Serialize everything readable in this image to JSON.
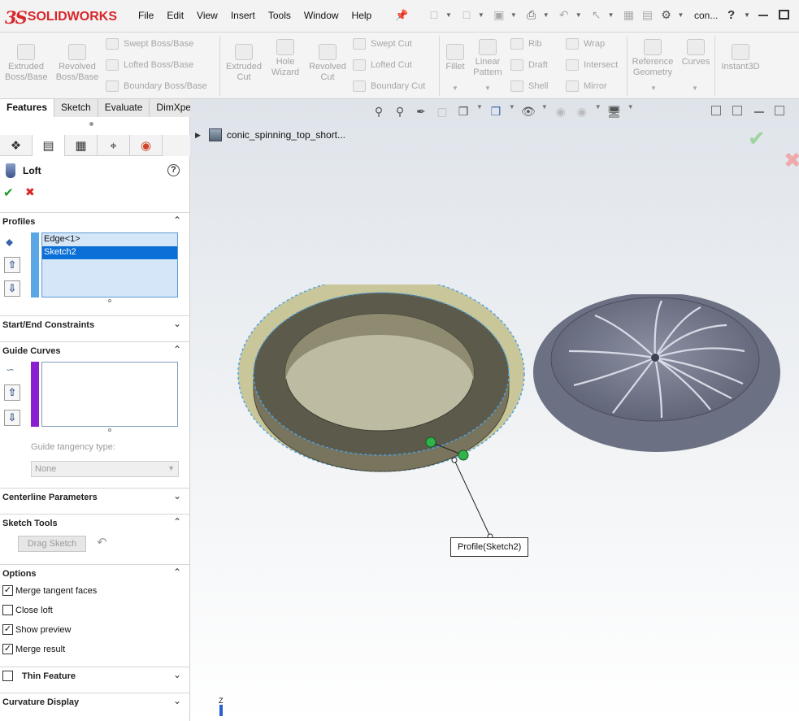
{
  "app": {
    "brand_ds": "3S",
    "brand_name": "SOLIDWORKS",
    "menus": [
      "File",
      "Edit",
      "View",
      "Insert",
      "Tools",
      "Window",
      "Help"
    ],
    "doc_name_short": "con...",
    "help_label": "?"
  },
  "icons": {
    "pin": "pin-icon",
    "new": "new-document-icon",
    "open": "open-icon",
    "save": "save-icon",
    "print": "print-icon",
    "undo": "undo-icon",
    "select": "select-icon",
    "rebuild": "rebuild-icon",
    "file_properties": "file-properties-icon",
    "options": "gear-icon"
  },
  "commands": {
    "extruded_boss": "Extruded\nBoss/Base",
    "revolved_boss": "Revolved\nBoss/Base",
    "swept_boss": "Swept Boss/Base",
    "lofted_boss": "Lofted Boss/Base",
    "boundary_boss": "Boundary Boss/Base",
    "extruded_cut": "Extruded\nCut",
    "hole_wizard": "Hole\nWizard",
    "revolved_cut": "Revolved\nCut",
    "swept_cut": "Swept Cut",
    "lofted_cut": "Lofted Cut",
    "boundary_cut": "Boundary Cut",
    "fillet": "Fillet",
    "linear_pattern": "Linear\nPattern",
    "rib": "Rib",
    "draft": "Draft",
    "shell": "Shell",
    "wrap": "Wrap",
    "intersect": "Intersect",
    "mirror": "Mirror",
    "reference_geometry": "Reference\nGeometry",
    "curves": "Curves",
    "instant3d": "Instant3D"
  },
  "tabs": [
    "Features",
    "Sketch",
    "Evaluate",
    "DimXpert"
  ],
  "property_manager": {
    "title": "Loft",
    "help": "?",
    "profiles_title": "Profiles",
    "profiles": [
      "Edge<1>",
      "Sketch2"
    ],
    "start_end_title": "Start/End Constraints",
    "guide_curves_title": "Guide Curves",
    "guide_tangency_label": "Guide tangency type:",
    "guide_tangency_value": "None",
    "centerline_title": "Centerline Parameters",
    "sketch_tools_title": "Sketch Tools",
    "drag_sketch_label": "Drag Sketch",
    "options_title": "Options",
    "options": [
      {
        "label": "Merge tangent faces",
        "checked": true
      },
      {
        "label": "Close loft",
        "checked": false
      },
      {
        "label": "Show preview",
        "checked": true
      },
      {
        "label": "Merge result",
        "checked": true
      }
    ],
    "thin_feature_label": "Thin Feature",
    "curvature_title": "Curvature Display"
  },
  "viewport": {
    "tree_item": "conic_spinning_top_short...",
    "callout": "Profile(Sketch2)",
    "triad_label": "Z"
  },
  "colors": {
    "brand": "#d9262a",
    "selection": "#0a6fd6",
    "profiles_bar": "#5aa7e6",
    "guide_bar": "#8a1fd0",
    "preview_yellow": "#c9c79a",
    "part_gray": "#6e7280",
    "ok_green": "#1a9a2a",
    "cancel_red": "#dd2222"
  }
}
